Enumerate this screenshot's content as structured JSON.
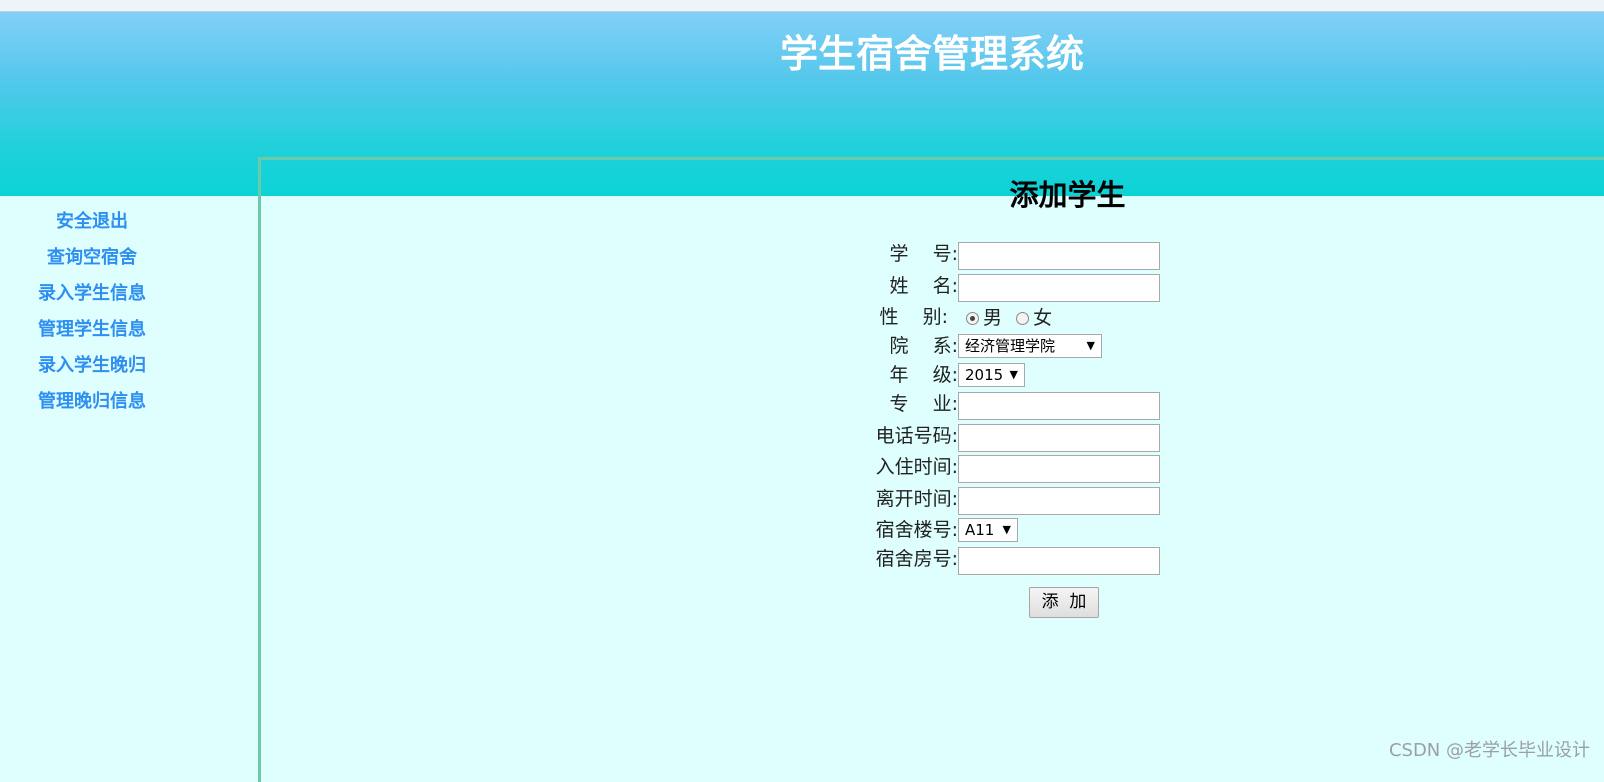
{
  "header": {
    "title": "学生宿舍管理系统"
  },
  "sidebar": {
    "items": [
      {
        "label": "安全退出"
      },
      {
        "label": "查询空宿舍"
      },
      {
        "label": "录入学生信息"
      },
      {
        "label": "管理学生信息"
      },
      {
        "label": "录入学生晚归"
      },
      {
        "label": "管理晚归信息"
      }
    ]
  },
  "form": {
    "title": "添加学生",
    "student_id_label": "学    号:",
    "name_label": "姓    名:",
    "gender_label": "性    别:",
    "gender_options": [
      "男",
      "女"
    ],
    "gender_selected": "男",
    "department_label": "院    系:",
    "department_value": "经济管理学院",
    "grade_label": "年    级:",
    "grade_value": "2015",
    "major_label": "专    业:",
    "phone_label": "电话号码:",
    "checkin_label": "入住时间:",
    "checkout_label": "离开时间:",
    "building_label": "宿舍楼号:",
    "building_value": "A11",
    "room_label": "宿舍房号:",
    "submit_label": "添  加"
  },
  "watermark": "CSDN @老学长毕业设计",
  "colors": {
    "header_gradient_top": "#83cff7",
    "header_gradient_bottom": "#0cd2d6",
    "page_background": "#dfffff",
    "nav_link": "#2e8ff0",
    "frame_border": "#6cc9a9"
  }
}
